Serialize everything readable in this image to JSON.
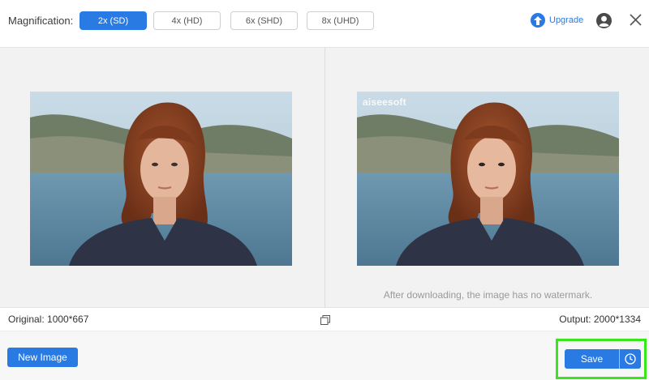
{
  "topbar": {
    "magnification_label": "Magnification:",
    "options": [
      {
        "label": "2x (SD)",
        "selected": true
      },
      {
        "label": "4x (HD)",
        "selected": false
      },
      {
        "label": "6x (SHD)",
        "selected": false
      },
      {
        "label": "8x (UHD)",
        "selected": false
      }
    ],
    "upgrade_label": "Upgrade",
    "icons": {
      "upgrade": "arrow-up-circle-icon",
      "account": "user-avatar-icon",
      "close": "close-icon"
    }
  },
  "preview": {
    "original_image": "portrait-photo",
    "output_image": "portrait-photo-enhanced",
    "watermark": "aiseesoft",
    "note": "After downloading, the image has no watermark."
  },
  "info": {
    "original": "Original: 1000*667",
    "output": "Output: 2000*1334",
    "compare_icon": "compare-icon"
  },
  "bottom": {
    "new_image_label": "New Image",
    "save_label": "Save",
    "schedule_icon": "clock-icon"
  },
  "colors": {
    "accent": "#2a7ae4",
    "highlight": "#39e51b",
    "panel": "#f2f2f2"
  }
}
